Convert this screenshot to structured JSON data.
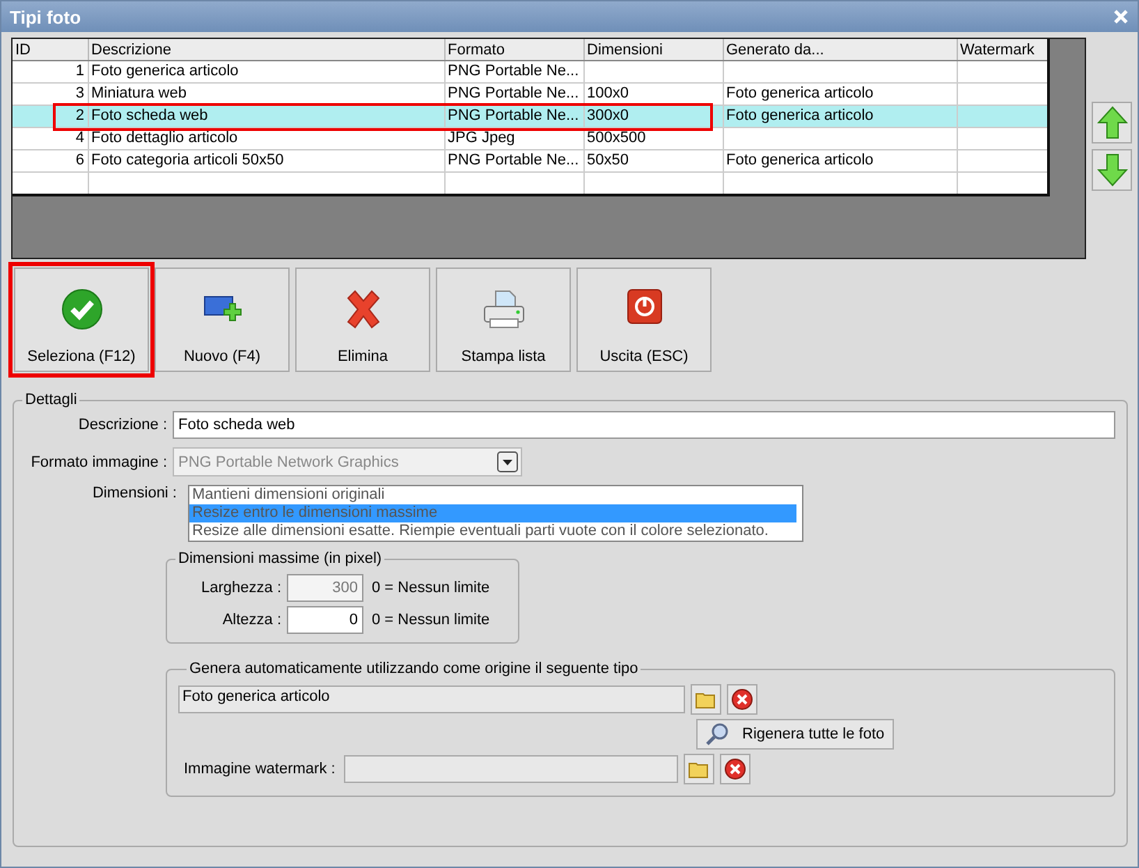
{
  "window": {
    "title": "Tipi foto"
  },
  "table": {
    "columns": [
      "ID",
      "Descrizione",
      "Formato",
      "Dimensioni",
      "Generato da...",
      "Watermark"
    ],
    "rows": [
      {
        "id": "1",
        "descrizione": "Foto generica articolo",
        "formato": "PNG Portable Ne...",
        "selected": false,
        "highlighted": false
      },
      {
        "id": "3",
        "descrizione": "Miniatura web",
        "formato": "PNG Portable Ne...",
        "dimensioni": "100x0",
        "generato_da": "Foto generica articolo",
        "selected": false,
        "highlighted": false
      },
      {
        "id": "2",
        "descrizione": "Foto scheda web",
        "formato": "PNG Portable Ne...",
        "dimensioni": "300x0",
        "generato_da": "Foto generica articolo",
        "selected": true,
        "highlighted": true
      },
      {
        "id": "4",
        "descrizione": "Foto dettaglio articolo",
        "formato": "JPG Jpeg",
        "dimensioni": "500x500",
        "selected": false,
        "highlighted": false
      },
      {
        "id": "6",
        "descrizione": "Foto categoria articoli 50x50",
        "formato": "PNG Portable Ne...",
        "dimensioni": "50x50",
        "generato_da": "Foto generica articolo",
        "selected": false,
        "highlighted": false
      }
    ]
  },
  "toolbar": [
    {
      "kind": "select",
      "label": "Seleziona (F12)",
      "highlighted": true
    },
    {
      "kind": "new",
      "label": "Nuovo (F4)",
      "highlighted": false
    },
    {
      "kind": "delete",
      "label": "Elimina",
      "highlighted": false
    },
    {
      "kind": "print",
      "label": "Stampa lista",
      "highlighted": false
    },
    {
      "kind": "exit",
      "label": "Uscita (ESC)",
      "highlighted": false
    }
  ],
  "details": {
    "title": "Dettagli",
    "descrizione": {
      "label": "Descrizione :",
      "value": "Foto scheda web"
    },
    "formato": {
      "label": "Formato immagine :",
      "value": "PNG Portable Network Graphics",
      "disabled": true
    },
    "dimensioni": {
      "label": "Dimensioni :",
      "options": [
        {
          "label": "Mantieni dimensioni originali",
          "selected": false
        },
        {
          "label": "Resize entro le dimensioni massime",
          "selected": true
        },
        {
          "label": "Resize alle dimensioni esatte. Riempie eventuali parti vuote con il colore selezionato.",
          "selected": false
        }
      ]
    },
    "max": {
      "title": "Dimensioni massime (in pixel)",
      "fields": [
        {
          "label": "Larghezza :",
          "value": "300",
          "disabled": true,
          "hint": "0 = Nessun limite"
        },
        {
          "label": "Altezza :",
          "value": "0",
          "disabled": false,
          "hint": "0 = Nessun limite"
        }
      ]
    },
    "genera": {
      "title": "Genera automaticamente utilizzando come origine il seguente tipo",
      "source": "Foto generica articolo",
      "regen": "Rigenera tutte le foto",
      "watermark_label": "Immagine watermark :"
    }
  }
}
